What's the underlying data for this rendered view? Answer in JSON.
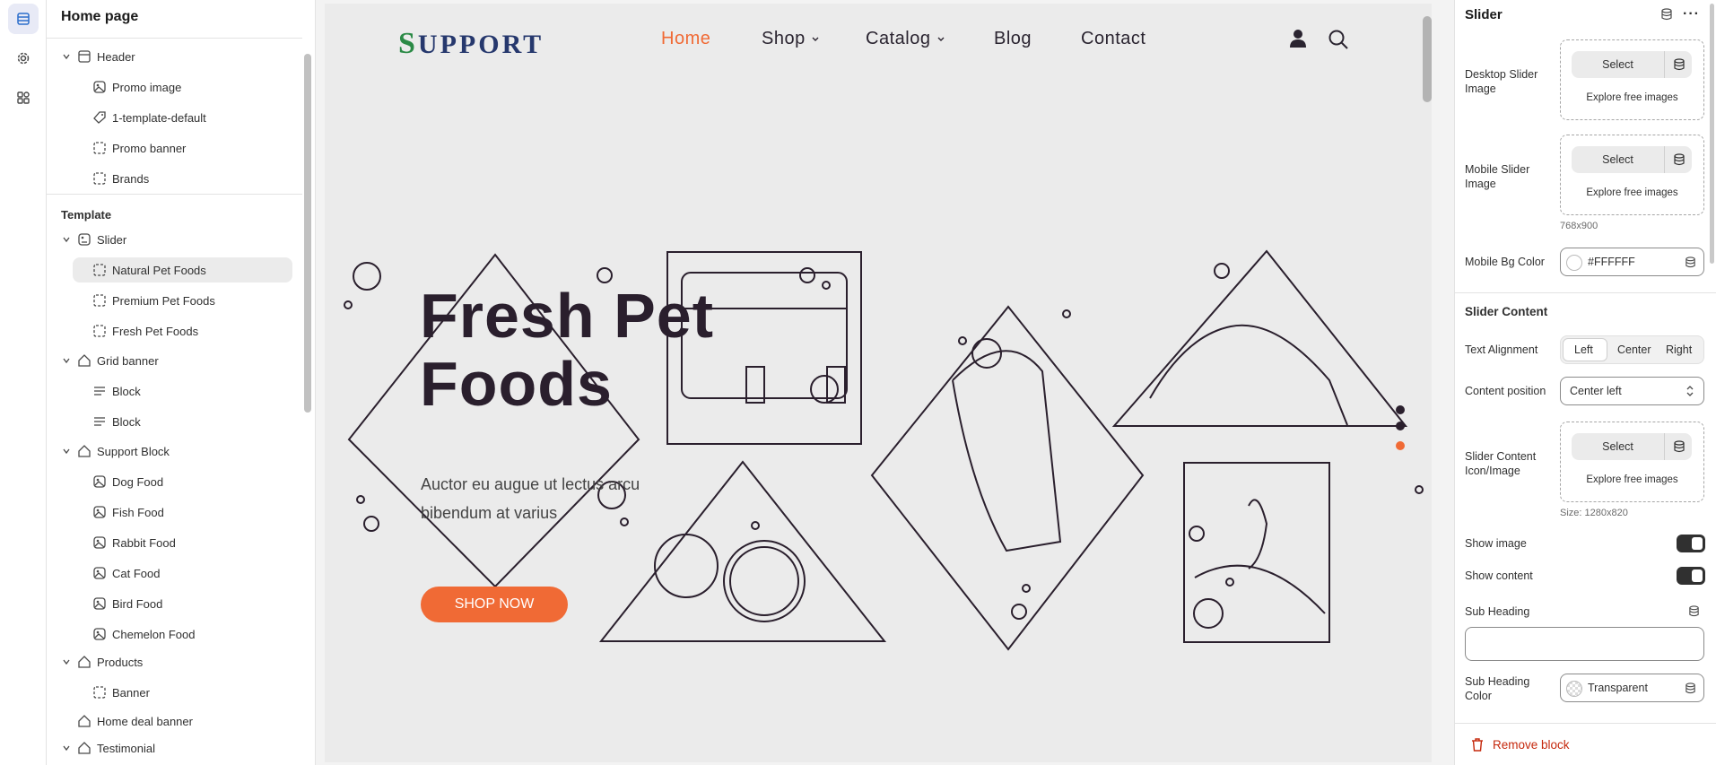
{
  "rail": {
    "items": [
      {
        "icon": "sections-icon",
        "active": true
      },
      {
        "icon": "gear-icon",
        "active": false
      },
      {
        "icon": "apps-icon",
        "active": false
      }
    ]
  },
  "tree": {
    "title": "Home page",
    "header_group": {
      "label": "Header",
      "children": [
        "Promo image",
        "1-template-default",
        "Promo banner",
        "Brands"
      ]
    },
    "template_label": "Template",
    "slider_group": {
      "label": "Slider",
      "children": [
        "Natural Pet Foods",
        "Premium Pet Foods",
        "Fresh Pet Foods"
      ]
    },
    "grid_group": {
      "label": "Grid banner",
      "children": [
        "Block",
        "Block"
      ]
    },
    "support_group": {
      "label": "Support Block",
      "children": [
        "Dog Food",
        "Fish Food",
        "Rabbit Food",
        "Cat Food",
        "Bird Food",
        "Chemelon Food"
      ]
    },
    "products_group": {
      "label": "Products",
      "children": [
        "Banner"
      ]
    },
    "home_deal": "Home deal banner",
    "testimonial": "Testimonial"
  },
  "preview": {
    "logo_first": "S",
    "logo_rest": "UPPORT",
    "nav": [
      {
        "label": "Home",
        "active": true,
        "dropdown": false
      },
      {
        "label": "Shop",
        "active": false,
        "dropdown": true
      },
      {
        "label": "Catalog",
        "active": false,
        "dropdown": true
      },
      {
        "label": "Blog",
        "active": false,
        "dropdown": false
      },
      {
        "label": "Contact",
        "active": false,
        "dropdown": false
      }
    ],
    "hero_title_1": "Fresh Pet",
    "hero_title_2": "Foods",
    "hero_subtitle": "Auctor eu augue ut lectus arcu bibendum at varius",
    "hero_button": "SHOP NOW",
    "accent_color": "#f06a35"
  },
  "panel": {
    "title": "Slider",
    "desktop_image_label": "Desktop Slider Image",
    "mobile_image_label": "Mobile Slider Image",
    "select_label": "Select",
    "explore_label": "Explore free images",
    "mobile_size_hint": "768x900",
    "mobile_bg_label": "Mobile Bg Color",
    "mobile_bg_value": "#FFFFFF",
    "content_section": "Slider Content",
    "text_align_label": "Text Alignment",
    "text_align_options": [
      "Left",
      "Center",
      "Right"
    ],
    "text_align_selected": "Left",
    "content_position_label": "Content position",
    "content_position_value": "Center left",
    "content_icon_label": "Slider Content Icon/Image",
    "content_size_hint": "Size: 1280x820",
    "show_image_label": "Show image",
    "show_image": true,
    "show_content_label": "Show content",
    "show_content": true,
    "sub_heading_label": "Sub Heading",
    "sub_heading_value": "",
    "sub_heading_color_label": "Sub Heading Color",
    "sub_heading_color_value": "Transparent",
    "remove_label": "Remove block"
  }
}
